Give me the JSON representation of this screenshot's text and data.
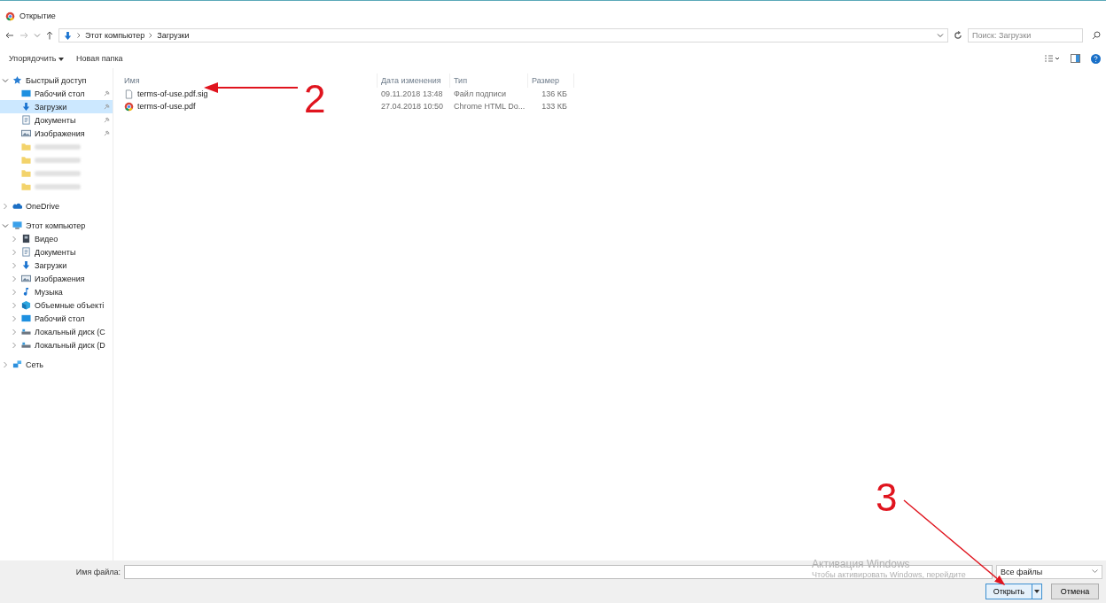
{
  "window": {
    "title": "Открытие"
  },
  "address_bar": {
    "breadcrumbs": [
      "Этот компьютер",
      "Загрузки"
    ],
    "search_placeholder": "Поиск: Загрузки"
  },
  "toolbar": {
    "organize": "Упорядочить",
    "new_folder": "Новая папка"
  },
  "sidebar": {
    "items": [
      {
        "label": "Быстрый доступ",
        "kind": "star",
        "expanded": true,
        "selected": false,
        "children": [
          {
            "label": "Рабочий стол",
            "kind": "desktop",
            "pinned": true,
            "selected": false
          },
          {
            "label": "Загрузки",
            "kind": "download",
            "pinned": true,
            "selected": true
          },
          {
            "label": "Документы",
            "kind": "document",
            "pinned": true,
            "selected": false
          },
          {
            "label": "Изображения",
            "kind": "pictures",
            "pinned": true,
            "selected": false
          },
          {
            "kind": "folder",
            "blurred": true,
            "pinned": false,
            "selected": false
          },
          {
            "kind": "folder",
            "blurred": true,
            "pinned": false,
            "selected": false
          },
          {
            "kind": "folder",
            "blurred": true,
            "pinned": false,
            "selected": false
          },
          {
            "kind": "folder",
            "blurred": true,
            "pinned": false,
            "selected": false
          }
        ]
      },
      {
        "label": "OneDrive",
        "kind": "cloud",
        "expanded": false,
        "selected": false
      },
      {
        "label": "Этот компьютер",
        "kind": "computer",
        "expanded": true,
        "selected": false,
        "children": [
          {
            "label": "Видео",
            "kind": "video",
            "expanded": false,
            "selected": false
          },
          {
            "label": "Документы",
            "kind": "document",
            "expanded": false,
            "selected": false
          },
          {
            "label": "Загрузки",
            "kind": "download",
            "expanded": false,
            "selected": false
          },
          {
            "label": "Изображения",
            "kind": "pictures",
            "expanded": false,
            "selected": false
          },
          {
            "label": "Музыка",
            "kind": "music",
            "expanded": false,
            "selected": false
          },
          {
            "label": "Объемные объекті",
            "kind": "cube",
            "expanded": false,
            "selected": false
          },
          {
            "label": "Рабочий стол",
            "kind": "desktop",
            "expanded": false,
            "selected": false
          },
          {
            "label": "Локальный диск (С",
            "kind": "drive",
            "expanded": false,
            "selected": false
          },
          {
            "label": "Локальный диск (D",
            "kind": "drive",
            "expanded": false,
            "selected": false
          }
        ]
      },
      {
        "label": "Сеть",
        "kind": "network",
        "expanded": false,
        "selected": false
      }
    ]
  },
  "table": {
    "columns": [
      "Имя",
      "Дата изменения",
      "Тип",
      "Размер"
    ],
    "rows": [
      {
        "kind": "file",
        "name": "terms-of-use.pdf.sig",
        "date": "09.11.2018 13:48",
        "type": "Файл подписи",
        "size": "136 КБ",
        "selected": false
      },
      {
        "kind": "chrome",
        "name": "terms-of-use.pdf",
        "date": "27.04.2018 10:50",
        "type": "Chrome HTML Do...",
        "size": "133 КБ",
        "selected": false
      }
    ]
  },
  "footer": {
    "filename_label": "Имя файла:",
    "filter": "Все файлы",
    "open_button": "Открыть",
    "cancel_button": "Отмена"
  },
  "activation_notice": {
    "title": "Активация Windows",
    "text": "Чтобы активировать Windows, перейдите"
  },
  "annotations": [
    {
      "label": "2"
    },
    {
      "label": "3"
    }
  ]
}
